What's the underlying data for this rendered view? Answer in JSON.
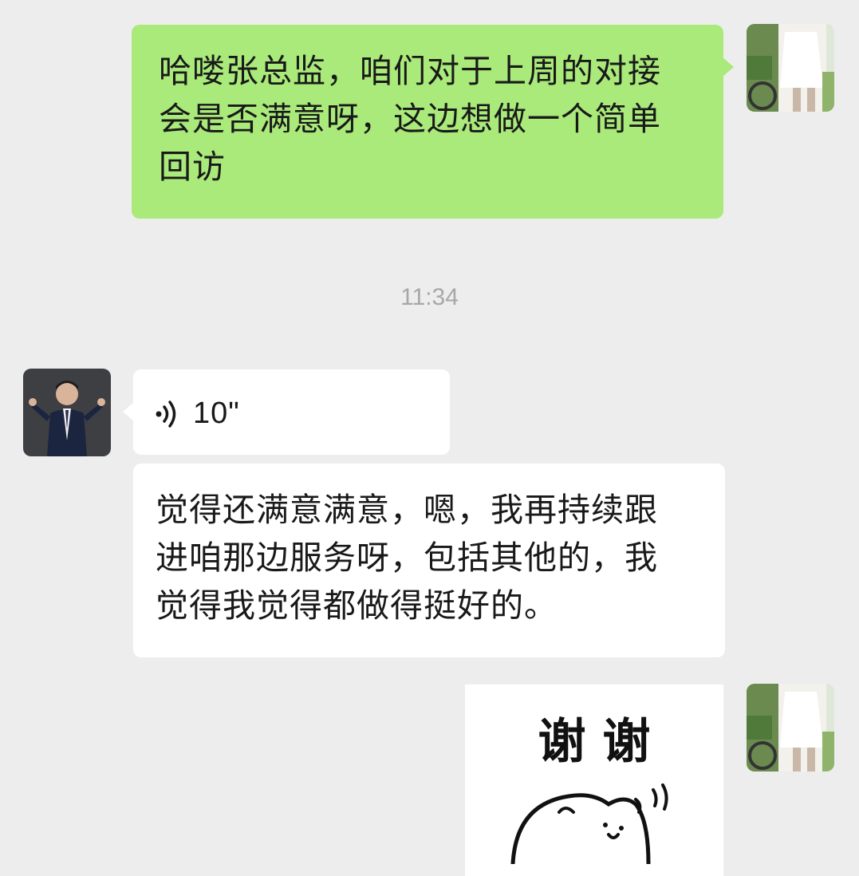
{
  "messages": [
    {
      "side": "right",
      "type": "text",
      "lines": [
        "哈喽张总监，咱们对于上周的对接",
        "会是否满意呀，这边想做一个简单",
        "回访"
      ]
    },
    {
      "type": "timestamp",
      "text": "11:34"
    },
    {
      "side": "left",
      "type": "voice",
      "duration": "10\""
    },
    {
      "side": "left",
      "type": "text",
      "lines": [
        "觉得还满意满意，嗯，我再持续跟",
        "进咱那边服务呀，包括其他的，我",
        "觉得我觉得都做得挺好的。"
      ]
    },
    {
      "side": "right",
      "type": "sticker",
      "text": "谢 谢"
    }
  ],
  "colors": {
    "background": "#ededed",
    "self_bubble": "#a9ea7a",
    "other_bubble": "#ffffff",
    "timestamp": "#a7a7a7"
  },
  "icons": {
    "voice": "voice-wave-icon"
  }
}
